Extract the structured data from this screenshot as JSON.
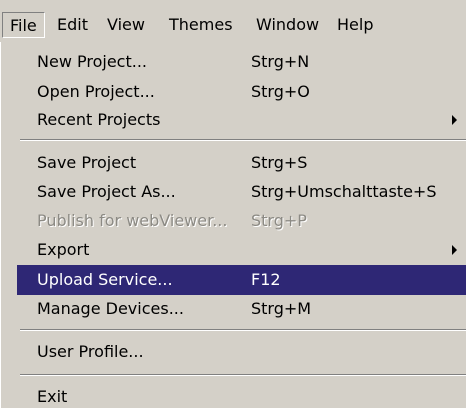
{
  "menubar": {
    "items": [
      "File",
      "Edit",
      "View",
      "Themes",
      "Window",
      "Help"
    ]
  },
  "colors": {
    "menu_background": "#d4d0c8",
    "highlight_background": "#2e2775",
    "highlight_text": "#ffffff",
    "disabled_text": "#8c8a84"
  },
  "file_menu": {
    "new_project": {
      "label": "New Project...",
      "shortcut": "Strg+N"
    },
    "open_project": {
      "label": "Open Project...",
      "shortcut": "Strg+O"
    },
    "recent_projects": {
      "label": "Recent Projects",
      "icon": "submenu-arrow-icon"
    },
    "save_project": {
      "label": "Save Project",
      "shortcut": "Strg+S"
    },
    "save_project_as": {
      "label": "Save Project As...",
      "shortcut": "Strg+Umschalttaste+S"
    },
    "publish_webviewer": {
      "label": "Publish for webViewer...",
      "shortcut": "Strg+P",
      "disabled": true
    },
    "export": {
      "label": "Export",
      "icon": "submenu-arrow-icon"
    },
    "upload_service": {
      "label": "Upload Service...",
      "shortcut": "F12",
      "highlighted": true
    },
    "manage_devices": {
      "label": "Manage Devices...",
      "shortcut": "Strg+M"
    },
    "user_profile": {
      "label": "User Profile..."
    },
    "exit": {
      "label": "Exit"
    }
  }
}
